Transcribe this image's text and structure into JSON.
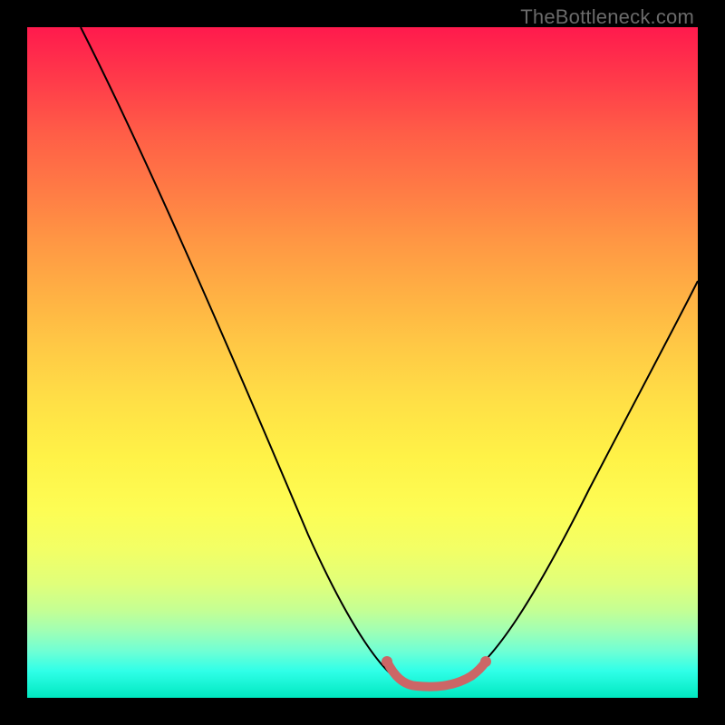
{
  "watermark": "TheBottleneck.com",
  "chart_data": {
    "type": "line",
    "title": "",
    "xlabel": "",
    "ylabel": "",
    "xlim": [
      0,
      100
    ],
    "ylim": [
      0,
      100
    ],
    "grid": false,
    "series": [
      {
        "name": "bottleneck-curve",
        "x": [
          8,
          15,
          22,
          29,
          36,
          43,
          50,
          52,
          55,
          58,
          61,
          64,
          67,
          73,
          79,
          85,
          91,
          97,
          100
        ],
        "values": [
          100,
          86,
          73,
          60,
          47,
          33,
          19,
          12,
          5,
          1,
          0,
          0,
          1,
          7,
          15,
          24,
          33,
          43,
          48
        ],
        "color": "#000000",
        "width": 2
      },
      {
        "name": "highlight-segment",
        "x": [
          55,
          56,
          58,
          60,
          62,
          64,
          65,
          67,
          68
        ],
        "values": [
          4,
          2.5,
          1.2,
          0.6,
          0.4,
          0.6,
          1.0,
          2.0,
          3.5
        ],
        "color": "#cc6666",
        "width": 8
      }
    ]
  }
}
